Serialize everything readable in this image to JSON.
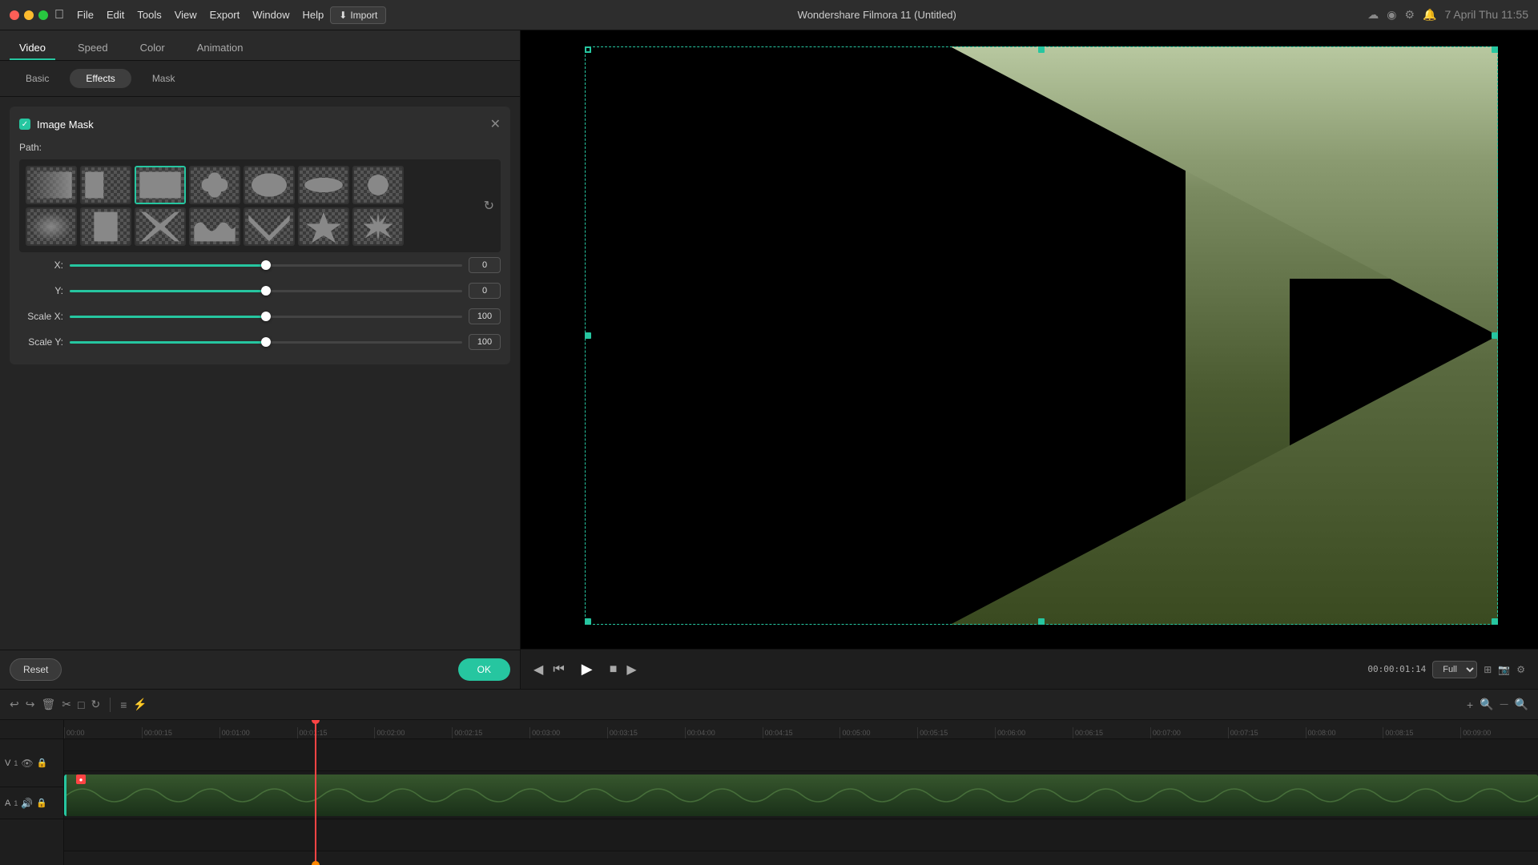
{
  "titlebar": {
    "apple": "",
    "app_name": "Wondershare Filmora 11",
    "menus": [
      "File",
      "Edit",
      "Tools",
      "View",
      "Export",
      "Window",
      "Help"
    ],
    "center_title": "Wondershare Filmora 11 (Untitled)",
    "import_label": "Import",
    "time_display": "7 April  Thu  11:55"
  },
  "panel": {
    "tabs": [
      {
        "label": "Video",
        "active": true
      },
      {
        "label": "Speed",
        "active": false
      },
      {
        "label": "Color",
        "active": false
      },
      {
        "label": "Animation",
        "active": false
      }
    ],
    "sub_tabs": [
      {
        "label": "Basic",
        "active": false
      },
      {
        "label": "Effects",
        "active": true
      },
      {
        "label": "Mask",
        "active": false
      }
    ],
    "mask_section": {
      "checkbox_checked": true,
      "title": "Image Mask",
      "path_label": "Path:",
      "shapes": [
        {
          "id": 0,
          "row": 0,
          "col": 0,
          "type": "rect_fade"
        },
        {
          "id": 1,
          "row": 0,
          "col": 1,
          "type": "rect_center"
        },
        {
          "id": 2,
          "row": 0,
          "col": 2,
          "type": "rect_selected",
          "selected": true
        },
        {
          "id": 3,
          "row": 0,
          "col": 3,
          "type": "clover"
        },
        {
          "id": 4,
          "row": 0,
          "col": 4,
          "type": "oval"
        },
        {
          "id": 5,
          "row": 0,
          "col": 5,
          "type": "oval_thin"
        },
        {
          "id": 6,
          "row": 0,
          "col": 6,
          "type": "oval_small"
        },
        {
          "id": 7,
          "row": 1,
          "col": 0,
          "type": "square_fade"
        },
        {
          "id": 8,
          "row": 1,
          "col": 1,
          "type": "rect_v"
        },
        {
          "id": 9,
          "row": 1,
          "col": 2,
          "type": "x_shape"
        },
        {
          "id": 10,
          "row": 1,
          "col": 3,
          "type": "wave"
        },
        {
          "id": 11,
          "row": 1,
          "col": 4,
          "type": "arrow_down"
        },
        {
          "id": 12,
          "row": 1,
          "col": 5,
          "type": "star"
        },
        {
          "id": 13,
          "row": 1,
          "col": 6,
          "type": "burst"
        }
      ]
    },
    "sliders": [
      {
        "label": "X:",
        "value": 0,
        "percent": 50
      },
      {
        "label": "Y:",
        "value": 0,
        "percent": 50
      },
      {
        "label": "Scale X:",
        "value": 100,
        "percent": 50
      },
      {
        "label": "Scale Y:",
        "value": 100,
        "percent": 50
      }
    ],
    "reset_label": "Reset",
    "ok_label": "OK"
  },
  "preview": {
    "time_code": "00:00:01:14",
    "zoom_label": "Full",
    "playback_prev_icon": "⏮",
    "playback_back_icon": "◀◀",
    "playback_play_icon": "▶",
    "playback_stop_icon": "■",
    "nav_left": "←",
    "nav_right": "→"
  },
  "timeline": {
    "current_time": "00:00",
    "markers": [
      "00:00",
      "00:00:15",
      "00:01:00",
      "00:01:15",
      "00:02:00",
      "00:02:15",
      "00:03:00",
      "00:03:15",
      "00:04:00",
      "00:04:15",
      "00:05:00",
      "00:05:15",
      "00:06:00",
      "00:06:15",
      "00:07:00",
      "00:07:15",
      "00:08:00",
      "00:08:15",
      "00:09:00"
    ],
    "track1_icon": "V1",
    "track2_icon": "A1",
    "playhead_position": "00:01:15"
  }
}
